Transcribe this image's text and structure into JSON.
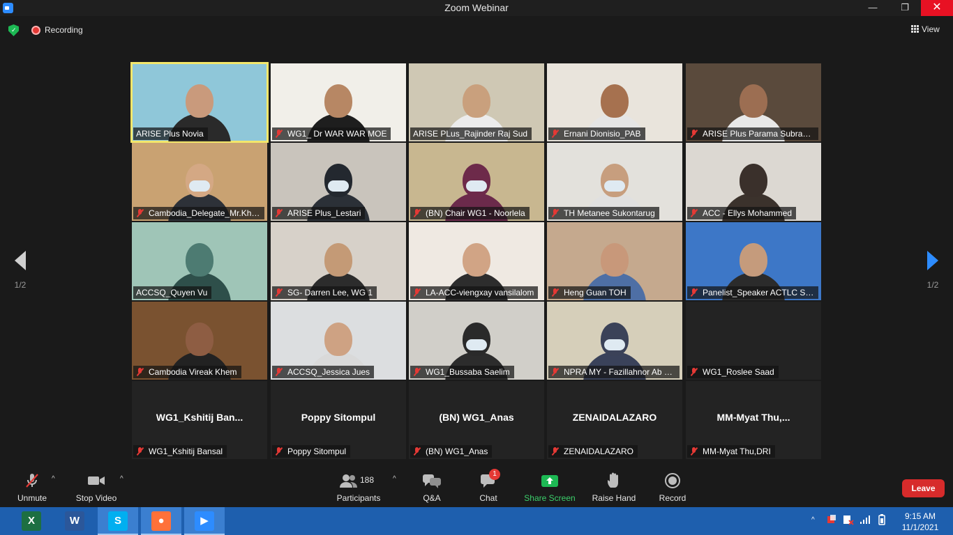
{
  "window": {
    "title": "Zoom Webinar",
    "minimize": "—",
    "maximize": "❐",
    "close": "✕"
  },
  "topbar": {
    "recording_label": "Recording",
    "view_label": "View"
  },
  "pager": {
    "left_label": "1/2",
    "right_label": "1/2"
  },
  "tiles": [
    {
      "name": "ARISE Plus Novia",
      "muted": false,
      "active": true,
      "bg": "#8fc7d9",
      "skin": "#c99a7c",
      "clothes": "#2a2a2a"
    },
    {
      "name": "WG1_ Dr WAR WAR MOE",
      "muted": true,
      "bg": "#f1efe9",
      "skin": "#b78764",
      "clothes": "#1e1e1e"
    },
    {
      "name": "ARISE PLus_Rajinder Raj Sud",
      "muted": false,
      "bg": "#cfc8b4",
      "skin": "#c9a07d",
      "clothes": "#ececec"
    },
    {
      "name": "Ernani Dionisio_PAB",
      "muted": true,
      "bg": "#e9e4dc",
      "skin": "#a6714f",
      "clothes": "#e5e5e5"
    },
    {
      "name": "ARISE Plus Parama Subramaniam",
      "muted": true,
      "bg": "#5a4a3c",
      "skin": "#9c6e52",
      "clothes": "#e8e8e8"
    },
    {
      "name": "Cambodia_Delegate_Mr.Khemra",
      "muted": true,
      "bg": "#c9a272",
      "skin": "#d4a884",
      "clothes": "#2d3138",
      "mask": true
    },
    {
      "name": "ARISE Plus_Lestari",
      "muted": true,
      "bg": "#c9c4bc",
      "skin": "#23282f",
      "clothes": "#2b3037",
      "mask": true
    },
    {
      "name": "(BN) Chair WG1 - Noorlela",
      "muted": true,
      "bg": "#c8b790",
      "skin": "#6d2a4a",
      "clothes": "#6b2a4b",
      "mask": true
    },
    {
      "name": "TH Metanee Sukontarug",
      "muted": true,
      "bg": "#e3e1dc",
      "skin": "#c79e7e",
      "clothes": "#e0e0e0",
      "mask": true
    },
    {
      "name": "ACC - Ellys Mohammed",
      "muted": true,
      "bg": "#dcd8d2",
      "skin": "#3a302b",
      "clothes": "#3b322c"
    },
    {
      "name": "ACCSQ_Quyen Vu",
      "muted": false,
      "bg": "#9fc5b7",
      "skin": "#4d7b72",
      "clothes": "#2e4f4a"
    },
    {
      "name": "SG- Darren Lee, WG 1",
      "muted": true,
      "bg": "#d7d1c9",
      "skin": "#c49a76",
      "clothes": "#2c2c2c"
    },
    {
      "name": "LA-ACC-viengxay vansilalom",
      "muted": true,
      "bg": "#efe9e2",
      "skin": "#d1a485",
      "clothes": "#2d2d2d"
    },
    {
      "name": "Heng Guan TOH",
      "muted": true,
      "bg": "#c5a98e",
      "skin": "#c8987a",
      "clothes": "#4e6fa5"
    },
    {
      "name": "Panelist_Speaker ACTLC Suchada",
      "muted": true,
      "bg": "#3d77c7",
      "skin": "#c59b7c",
      "clothes": "#2b2b2b"
    },
    {
      "name": "Cambodia Vireak Khem",
      "muted": true,
      "bg": "#7a5230",
      "skin": "#8e5d43",
      "clothes": "#222222"
    },
    {
      "name": "ACCSQ_Jessica Jues",
      "muted": true,
      "bg": "#dcdee0",
      "skin": "#cea283",
      "clothes": "#d9d9d9"
    },
    {
      "name": "WG1_Bussaba Saelim",
      "muted": true,
      "bg": "#d1cfc9",
      "skin": "#2a2a2a",
      "clothes": "#2c2c2c",
      "mask": true
    },
    {
      "name": "NPRA MY - Fazillahnor Ab Rahim",
      "muted": true,
      "bg": "#d6cfba",
      "skin": "#3b4258",
      "clothes": "#3a425a",
      "mask": true
    },
    {
      "name": "WG1_Roslee Saad",
      "muted": true,
      "novideo": true,
      "bg": "#232323"
    },
    {
      "name": "WG1_Kshitij Bansal",
      "display": "WG1_Kshitij  Ban...",
      "muted": true,
      "novideo": true,
      "bg": "#232323"
    },
    {
      "name": "Poppy Sitompul",
      "display": "Poppy Sitompul",
      "muted": true,
      "novideo": true,
      "bg": "#232323"
    },
    {
      "name": "(BN) WG1_Anas",
      "display": "(BN) WG1_Anas",
      "muted": true,
      "novideo": true,
      "bg": "#232323"
    },
    {
      "name": "ZENAIDALAZARO",
      "display": "ZENAIDALAZARO",
      "muted": true,
      "novideo": true,
      "bg": "#232323"
    },
    {
      "name": "MM-Myat Thu,DRI",
      "display": "MM-Myat  Thu,...",
      "muted": true,
      "novideo": true,
      "bg": "#232323"
    }
  ],
  "toolbar": {
    "unmute": "Unmute",
    "stop_video": "Stop Video",
    "participants": "Participants",
    "participants_count": "188",
    "qa": "Q&A",
    "chat": "Chat",
    "chat_badge": "1",
    "share_screen": "Share Screen",
    "raise_hand": "Raise Hand",
    "record": "Record",
    "leave": "Leave",
    "caret": "^"
  },
  "taskbar": {
    "apps": [
      {
        "name": "excel",
        "glyph": "X",
        "color": "#1d6f42"
      },
      {
        "name": "word",
        "glyph": "W",
        "color": "#2b579a"
      },
      {
        "name": "skype",
        "glyph": "S",
        "color": "#00aff0"
      },
      {
        "name": "firefox",
        "glyph": "●",
        "color": "#ff7139"
      },
      {
        "name": "zoom",
        "glyph": "▶",
        "color": "#2d8cff"
      }
    ],
    "tray_chevron": "^",
    "time": "9:15 AM",
    "date": "11/1/2021"
  },
  "colors": {
    "accent": "#2d8cff",
    "active_border": "#f3e76b",
    "leave": "#d72b2b",
    "share": "#1db954"
  }
}
